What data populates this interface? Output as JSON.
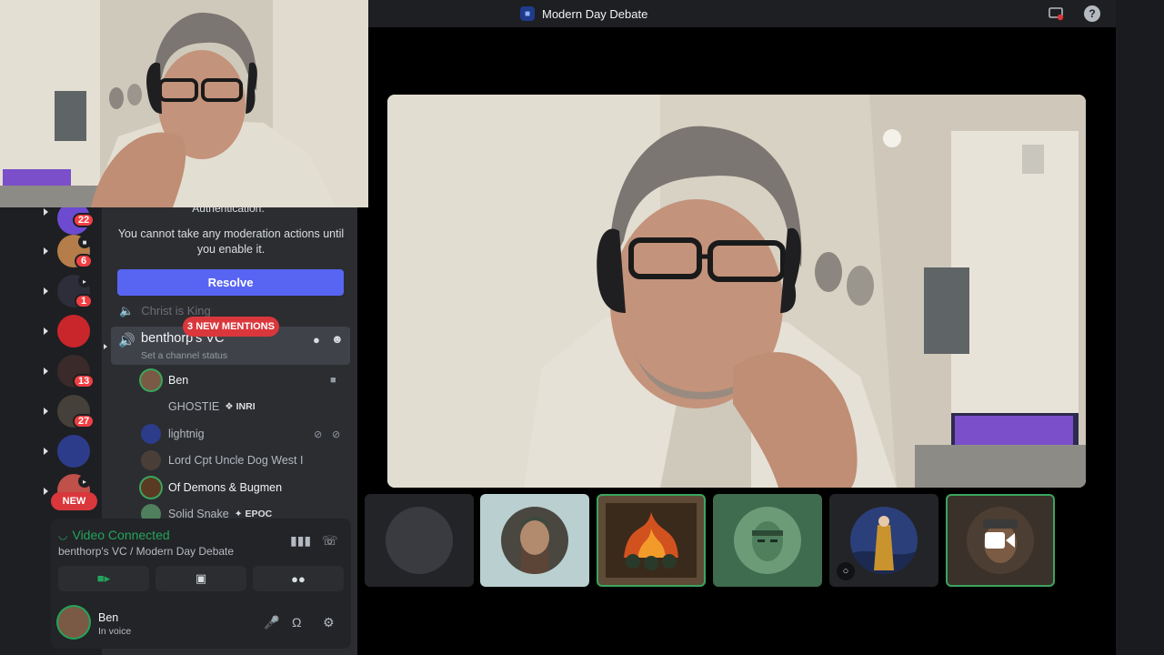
{
  "top_bar": {
    "server_title": "Modern Day Debate"
  },
  "banner": {
    "cut_heading": "Authentication.",
    "message": "You cannot take any moderation actions until you enable it.",
    "resolve_label": "Resolve"
  },
  "guilds": [
    {
      "badge": "22"
    },
    {
      "badge": "6"
    },
    {
      "badge": "1"
    },
    {
      "badge": ""
    },
    {
      "badge": "13"
    },
    {
      "badge": "27"
    },
    {
      "badge": ""
    },
    {
      "badge": ""
    }
  ],
  "new_label": "NEW",
  "channels": {
    "faded_name": "Christ is King",
    "mentions_label": "3 NEW MENTIONS",
    "voice_channel": {
      "name": "benthorp's VC",
      "status_placeholder": "Set a channel status"
    },
    "members": [
      {
        "name": "Ben",
        "tag": ""
      },
      {
        "name": "GHOSTIE",
        "tag": "INRI"
      },
      {
        "name": "lightnig",
        "tag": ""
      },
      {
        "name": "Lord Cpt Uncle Dog West I",
        "tag": ""
      },
      {
        "name": "Of Demons & Bugmen",
        "tag": ""
      },
      {
        "name": "Solid Snake",
        "tag": "EPOC"
      }
    ]
  },
  "voice_panel": {
    "status": "Video Connected",
    "location": "benthorp's VC / Modern Day Debate"
  },
  "user": {
    "name": "Ben",
    "status": "In voice"
  },
  "colors": {
    "accent": "#5865f2",
    "connected_green": "#23a55a",
    "alert_red": "#da373c",
    "speaking_ring": "#3ba55d"
  }
}
